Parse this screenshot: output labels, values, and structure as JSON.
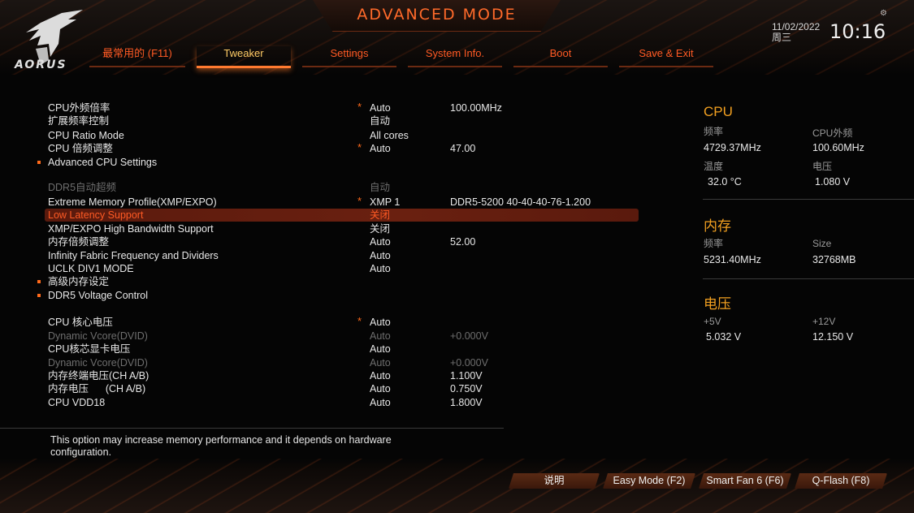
{
  "header": {
    "mode_title": "ADVANCED MODE",
    "logo_text": "AORUS",
    "date": "11/02/2022",
    "weekday": "周三",
    "time": "10:16"
  },
  "tabs": [
    {
      "label": "最常用的 (F11)",
      "active": false
    },
    {
      "label": "Tweaker",
      "active": true
    },
    {
      "label": "Settings",
      "active": false
    },
    {
      "label": "System Info.",
      "active": false
    },
    {
      "label": "Boot",
      "active": false
    },
    {
      "label": "Save & Exit",
      "active": false
    }
  ],
  "settings": [
    {
      "label": "CPU外频倍率",
      "star": true,
      "value": "Auto",
      "extra": "100.00MHz"
    },
    {
      "label": "扩展频率控制",
      "star": false,
      "value": "自动",
      "extra": ""
    },
    {
      "label": "CPU Ratio Mode",
      "star": false,
      "value": "All cores",
      "extra": ""
    },
    {
      "label": "CPU 倍频调整",
      "star": true,
      "value": "Auto",
      "extra": "47.00"
    },
    {
      "label": "Advanced CPU Settings",
      "submenu": true
    },
    {
      "label": "DDR5自动超频",
      "dim": true,
      "value": "自动",
      "extra": ""
    },
    {
      "label": "Extreme Memory Profile(XMP/EXPO)",
      "star": true,
      "value": "XMP 1",
      "extra": "DDR5-5200 40-40-40-76-1.200"
    },
    {
      "label": "Low Latency Support",
      "highlighted": true,
      "value": "关闭",
      "extra": ""
    },
    {
      "label": "XMP/EXPO High Bandwidth Support",
      "value": "关闭",
      "extra": ""
    },
    {
      "label": "内存倍频调整",
      "value": "Auto",
      "extra": "52.00"
    },
    {
      "label": "Infinity Fabric Frequency and Dividers",
      "value": "Auto",
      "extra": ""
    },
    {
      "label": "UCLK DIV1 MODE",
      "value": "Auto",
      "extra": ""
    },
    {
      "label": "高级内存设定",
      "submenu": true
    },
    {
      "label": "DDR5 Voltage Control",
      "submenu": true
    },
    {
      "label": "CPU 核心电压",
      "star": true,
      "value": "Auto",
      "extra": ""
    },
    {
      "label": "Dynamic Vcore(DVID)",
      "dim": true,
      "value": "Auto",
      "extra": "+0.000V"
    },
    {
      "label": "CPU核芯显卡电压",
      "value": "Auto",
      "extra": ""
    },
    {
      "label": "Dynamic Vcore(DVID)",
      "dim": true,
      "value": "Auto",
      "extra": "+0.000V"
    },
    {
      "label": "内存终端电压(CH A/B)",
      "value": "Auto",
      "extra": "1.100V"
    },
    {
      "label": "内存电压      (CH A/B)",
      "value": "Auto",
      "extra": "0.750V"
    },
    {
      "label": "CPU VDD18",
      "value": "Auto",
      "extra": "1.800V"
    }
  ],
  "help_text": "This option may increase memory performance and it depends on hardware configuration.",
  "sidebar": {
    "cpu": {
      "title": "CPU",
      "freq_label": "频率",
      "freq_value": "4729.37MHz",
      "bclk_label": "CPU外频",
      "bclk_value": "100.60MHz",
      "temp_label": "温度",
      "temp_value": "32.0 °C",
      "volt_label": "电压",
      "volt_value": "1.080 V"
    },
    "memory": {
      "title": "内存",
      "freq_label": "频率",
      "freq_value": "5231.40MHz",
      "size_label": "Size",
      "size_value": "32768MB"
    },
    "voltage": {
      "title": "电压",
      "v5_label": "+5V",
      "v5_value": "5.032 V",
      "v12_label": "+12V",
      "v12_value": "12.150 V"
    }
  },
  "footer_buttons": [
    "说明",
    "Easy Mode (F2)",
    "Smart Fan 6 (F6)",
    "Q-Flash (F8)"
  ],
  "colors": {
    "accent": "#ff5a24",
    "highlight": "#6a2010",
    "sidebar_title": "#f2a020"
  }
}
